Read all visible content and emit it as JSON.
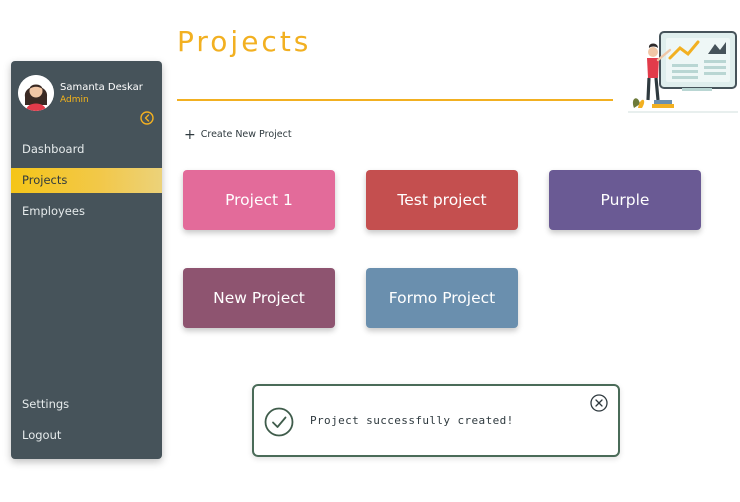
{
  "user": {
    "name": "Samanta Deskar",
    "role": "Admin"
  },
  "sidebar": {
    "items": [
      {
        "label": "Dashboard",
        "active": false
      },
      {
        "label": "Projects",
        "active": true
      },
      {
        "label": "Employees",
        "active": false
      }
    ],
    "bottom_items": [
      {
        "label": "Settings"
      },
      {
        "label": "Logout"
      }
    ]
  },
  "header": {
    "title": "Projects"
  },
  "actions": {
    "create_label": "Create New Project"
  },
  "projects": [
    {
      "name": "Project 1",
      "color": "#e36b9a"
    },
    {
      "name": "Test project",
      "color": "#c44f4f"
    },
    {
      "name": "Purple",
      "color": "#6a5a94"
    },
    {
      "name": "New Project",
      "color": "#8e5470"
    },
    {
      "name": "Formo Project",
      "color": "#6a8fae"
    }
  ],
  "toast": {
    "message": "Project successfully created!"
  },
  "colors": {
    "accent": "#f2b021",
    "sidebar": "#46535a",
    "toast_border": "#4a6b58"
  },
  "icons": {
    "avatar": "avatar-icon",
    "collapse": "arrow-left-circle-icon",
    "plus": "plus-icon",
    "success": "check-circle-icon",
    "close": "close-circle-icon"
  }
}
